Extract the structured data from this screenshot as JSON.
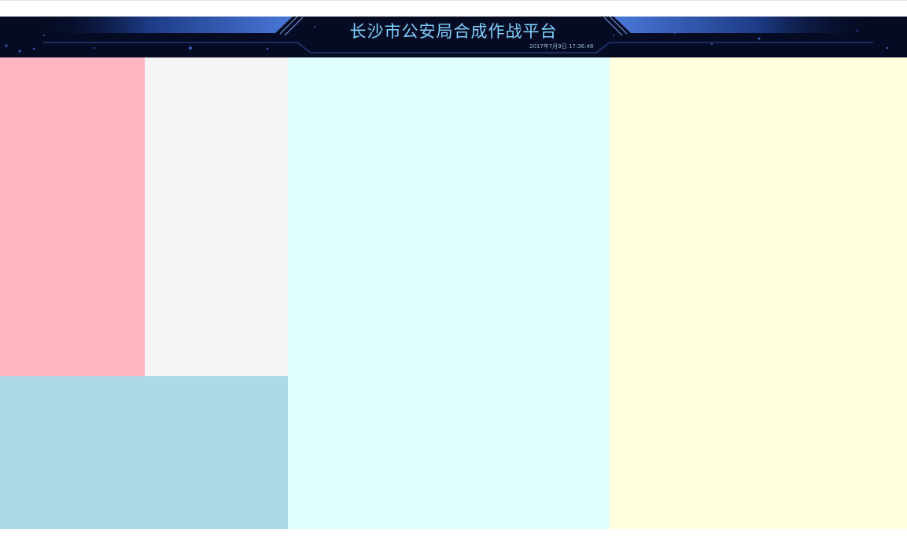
{
  "header": {
    "title": "长沙市公安局合成作战平台",
    "datetime": "2017年7月9日 17:36:48"
  },
  "panels": {
    "left_top": {
      "color": "#ffb6c1"
    },
    "left_middle": {
      "color": "#f4f4f4"
    },
    "left_bottom": {
      "color": "#add8e6"
    },
    "center": {
      "color": "#e0ffff"
    },
    "right": {
      "color": "#ffffe0"
    }
  },
  "colors": {
    "header_background": "#050b22",
    "header_accent": "#3c69c8",
    "title_text": "#7fd0ff"
  }
}
